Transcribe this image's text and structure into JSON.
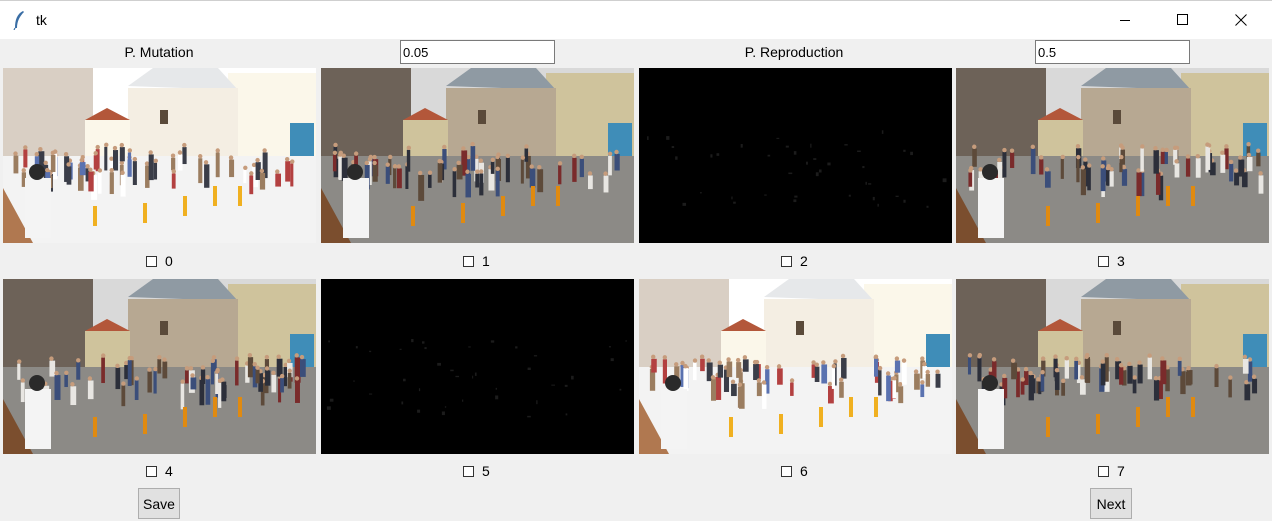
{
  "window": {
    "title": "tk"
  },
  "params": {
    "mutation": {
      "label": "P. Mutation",
      "value": "0.05"
    },
    "reproduction": {
      "label": "P. Reproduction",
      "value": "0.5"
    }
  },
  "cells": [
    {
      "label": "0",
      "variant": "bright"
    },
    {
      "label": "1",
      "variant": "normal"
    },
    {
      "label": "2",
      "variant": "dark"
    },
    {
      "label": "3",
      "variant": "normal"
    },
    {
      "label": "4",
      "variant": "normal"
    },
    {
      "label": "5",
      "variant": "dark"
    },
    {
      "label": "6",
      "variant": "bright"
    },
    {
      "label": "7",
      "variant": "normal"
    }
  ],
  "buttons": {
    "save": "Save",
    "next": "Next"
  },
  "icons": {
    "app": "feather-icon",
    "minimize": "minimize-icon",
    "maximize": "maximize-icon",
    "close": "close-icon"
  }
}
